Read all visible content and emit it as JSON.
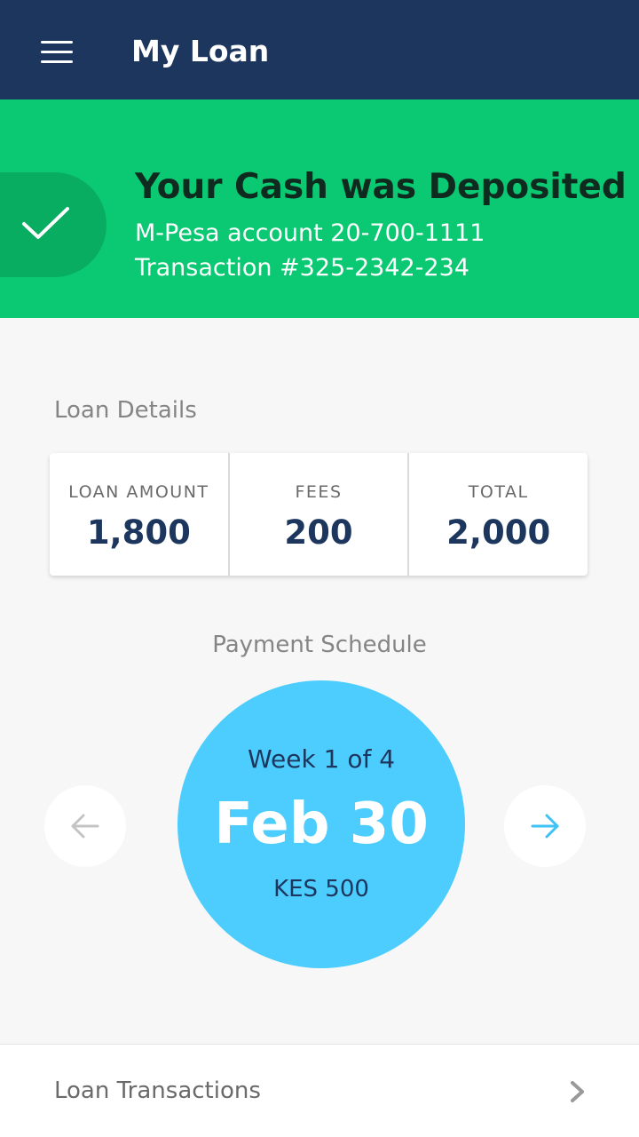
{
  "appbar": {
    "title": "My Loan",
    "menu_icon": "hamburger-menu-icon"
  },
  "banner": {
    "title": "Your Cash was Deposited",
    "account_line": "M-Pesa account 20-700-1111",
    "transaction_line": "Transaction #325-2342-234",
    "icon": "checkmark-icon",
    "color": "#0bc872"
  },
  "loan_details": {
    "heading": "Loan Details",
    "items": [
      {
        "label": "LOAN AMOUNT",
        "value": "1,800"
      },
      {
        "label": "FEES",
        "value": "200"
      },
      {
        "label": "TOTAL",
        "value": "2,000"
      }
    ]
  },
  "schedule": {
    "heading": "Payment Schedule",
    "week": "Week 1 of 4",
    "date": "Feb 30",
    "amount": "KES 500",
    "prev_icon": "arrow-left-icon",
    "next_icon": "arrow-right-icon",
    "accent": "#4dcdfd"
  },
  "footer": {
    "label": "Loan Transactions",
    "icon": "chevron-right-icon"
  },
  "colors": {
    "navy": "#1d365d",
    "green": "#0bc872",
    "blue": "#4dcdfd",
    "background": "#f7f7f7"
  }
}
